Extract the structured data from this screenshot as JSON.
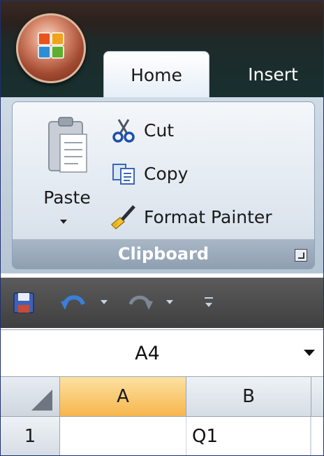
{
  "app": {
    "logo_icon": "office-button-icon"
  },
  "tabs": [
    {
      "label": "Home",
      "active": true
    },
    {
      "label": "Insert",
      "active": false
    }
  ],
  "clipboard_group": {
    "title": "Clipboard",
    "paste": {
      "label": "Paste",
      "icon": "paste-icon"
    },
    "commands": [
      {
        "label": "Cut",
        "icon": "scissors-icon"
      },
      {
        "label": "Copy",
        "icon": "copy-icon"
      },
      {
        "label": "Format Painter",
        "icon": "paintbrush-icon"
      }
    ],
    "launcher_icon": "dialog-launcher-icon"
  },
  "quick_access": {
    "items": [
      "save-icon",
      "undo-icon",
      "redo-icon",
      "customize-icon"
    ]
  },
  "name_box": {
    "value": "A4"
  },
  "grid": {
    "columns": [
      "A",
      "B"
    ],
    "selected_column": "A",
    "rows": [
      {
        "header": "1",
        "cells": [
          "",
          "Q1"
        ]
      }
    ]
  },
  "colors": {
    "title_bg": "#2b211d",
    "ribbon_bg": "#cfdbe6",
    "selected_header": "#f7b64c",
    "qat_bg": "#4a4a4a"
  }
}
